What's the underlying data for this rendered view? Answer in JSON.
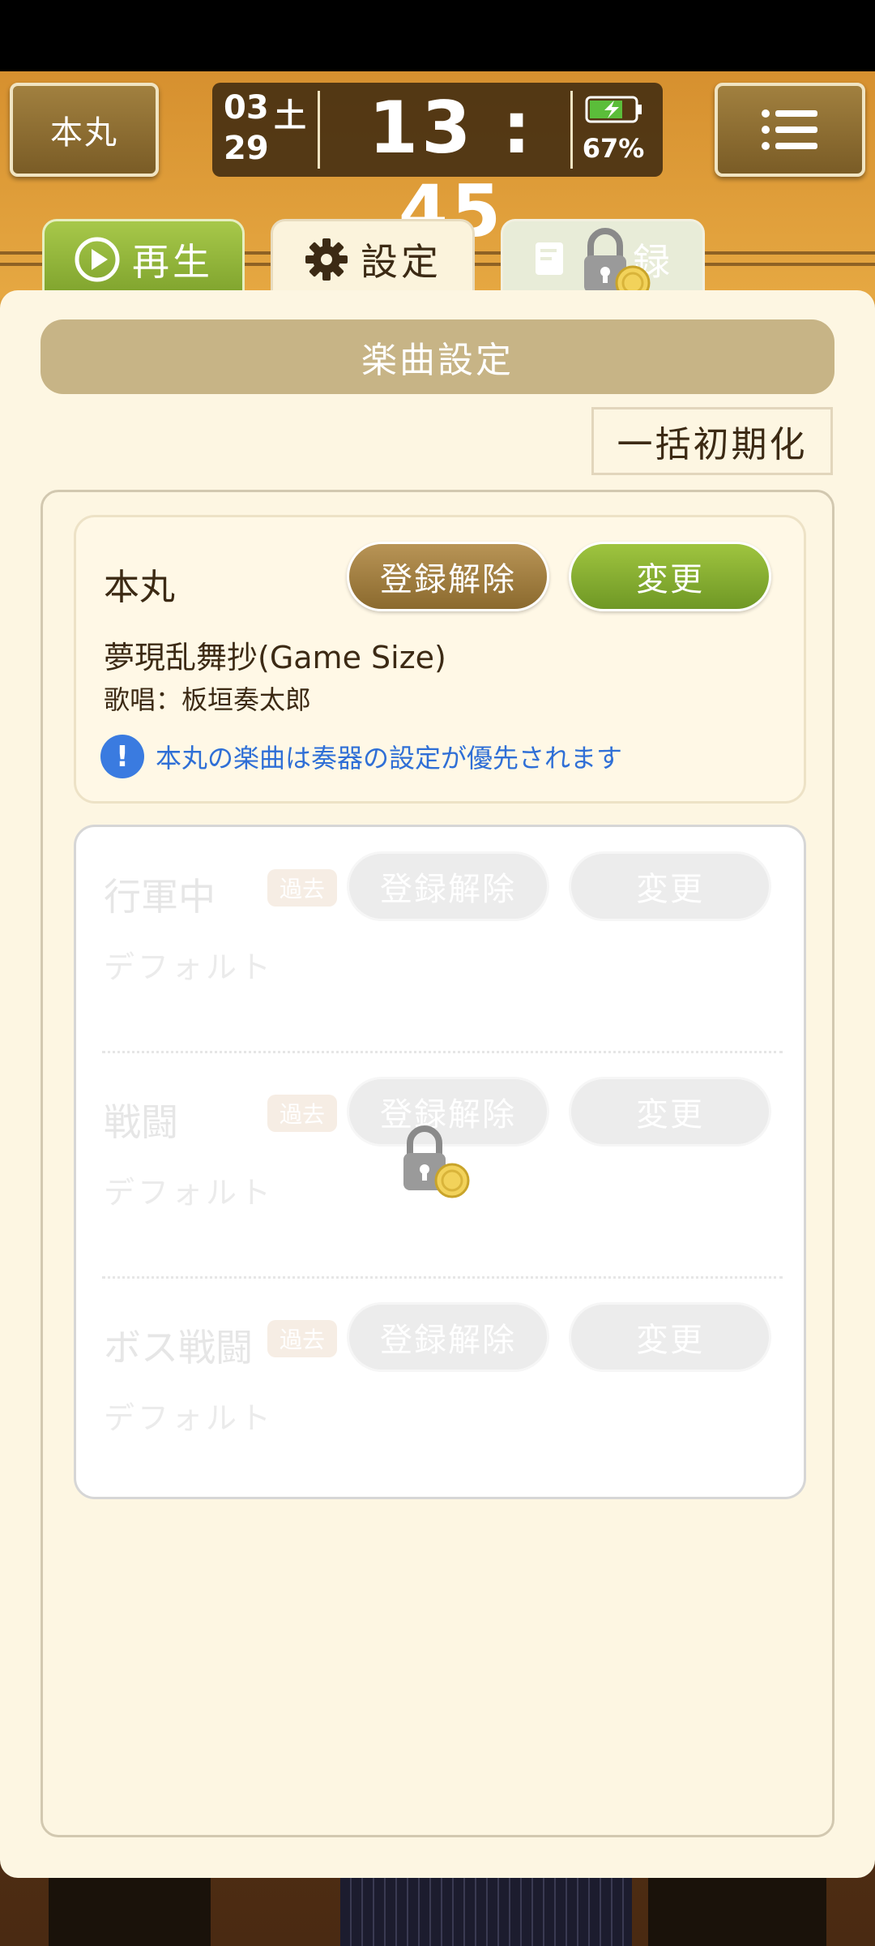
{
  "header": {
    "home_label": "本丸",
    "date": {
      "month": "03",
      "day_of_week": "土",
      "day": "29"
    },
    "time": "13 : 45",
    "battery_percent": "67%",
    "menu_icon": "hamburger-menu-icon"
  },
  "tabs": [
    {
      "label": "再生",
      "icon": "play-icon",
      "state": "inactive"
    },
    {
      "label": "設定",
      "icon": "gear-icon",
      "state": "active"
    },
    {
      "label": "録",
      "icon": "record-edit-icon",
      "state": "locked"
    }
  ],
  "section": {
    "title": "楽曲設定",
    "reset_all_label": "一括初期化"
  },
  "main_card": {
    "title": "本丸",
    "unregister_label": "登録解除",
    "change_label": "変更",
    "song_name": "夢現乱舞抄(Game Size)",
    "singer": "歌唱：板垣奏太郎",
    "notice": "本丸の楽曲は奏器の設定が優先されます"
  },
  "locked_rows": [
    {
      "title": "行軍中",
      "badge": "過去",
      "unregister_label": "登録解除",
      "change_label": "変更",
      "value": "デフォルト"
    },
    {
      "title": "戦闘",
      "badge": "過去",
      "unregister_label": "登録解除",
      "change_label": "変更",
      "value": "デフォルト"
    },
    {
      "title": "ボス戦闘",
      "badge": "過去",
      "unregister_label": "登録解除",
      "change_label": "変更",
      "value": "デフォルト"
    }
  ],
  "colors": {
    "accent_green": "#8db535",
    "accent_brown": "#a1803f",
    "notice_blue": "#2f6fd6",
    "panel_bg": "#fdf6e2"
  }
}
